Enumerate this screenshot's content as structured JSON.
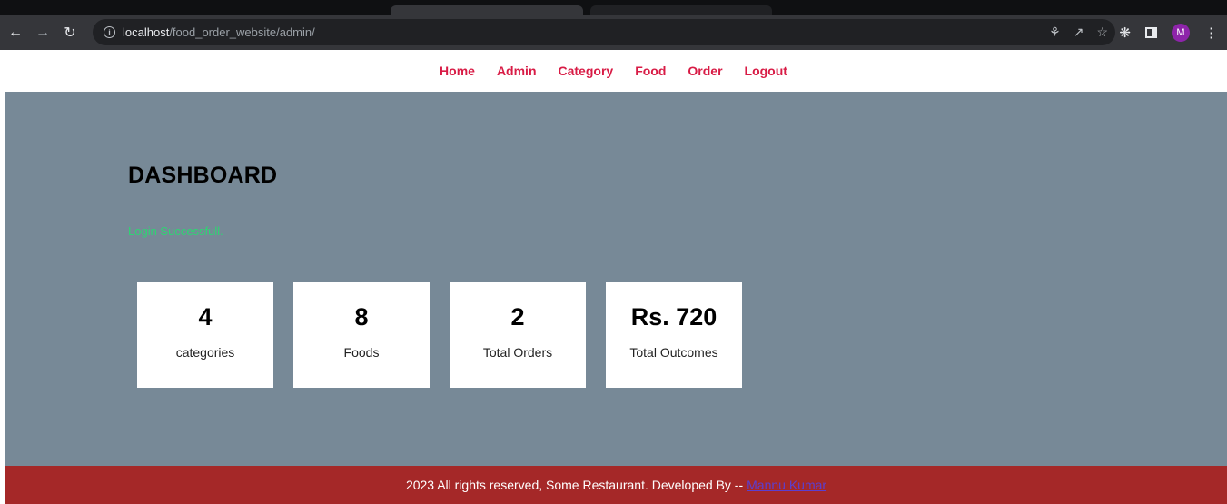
{
  "browser": {
    "url_host": "localhost",
    "url_path": "/food_order_website/admin/",
    "profile_initial": "M"
  },
  "nav": {
    "items": [
      "Home",
      "Admin",
      "Category",
      "Food",
      "Order",
      "Logout"
    ]
  },
  "dashboard": {
    "title": "DASHBOARD",
    "message": "Login Successfull."
  },
  "cards": [
    {
      "value": "4",
      "label": "categories"
    },
    {
      "value": "8",
      "label": "Foods"
    },
    {
      "value": "2",
      "label": "Total Orders"
    },
    {
      "value": "Rs. 720",
      "label": "Total Outcomes"
    }
  ],
  "footer": {
    "text": "2023 All rights reserved, Some Restaurant. Developed By --",
    "link": "Mannu Kumar"
  },
  "colors": {
    "nav_link": "#d81b45",
    "main_bg": "#778997",
    "footer_bg": "#a52828",
    "success": "#2ed573"
  }
}
